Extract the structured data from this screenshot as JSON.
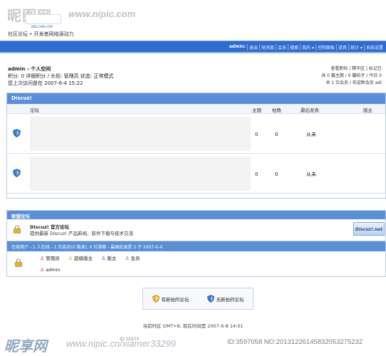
{
  "watermark": {
    "site_cn": "昵图网",
    "url_top": "www.nipic.com",
    "bottom_cn": "昵享网",
    "url_bottom": "www.nipic.cn/xiamer33299",
    "id_text": "ID:3597058 NO:20131226145832053275232",
    "tiny": "ID:35970"
  },
  "header": {
    "logo_sub": "BBS.CHIN.COM",
    "slogan": "社区论坛 • 开发者网络源动力"
  },
  "nav": {
    "items": [
      "admin:",
      "退出",
      "短消息",
      "会员",
      "搜索",
      "我的 ▾",
      "控制面板",
      "道具",
      "统计 ▾",
      "系统设置"
    ]
  },
  "user": {
    "title": "admin - 个人空间",
    "line2": "积分: 0 详细积分 / 头衔: 管理员 状态: 正常模式",
    "line3": "您上次访问是在 2007-6-4 15:22"
  },
  "right_info": {
    "line1": "查看新帖 | 精华区 | 标记已",
    "line2": "共 0 篇主题 / 0 篇帖子 / 今日 0",
    "line3": "共 1 位会员 / 欢迎新会员 adi"
  },
  "forum": {
    "category": "Discuz!",
    "columns": {
      "forum": "论坛",
      "topics": "主题",
      "posts": "帖数",
      "last": "最后发表",
      "moderator": "版主"
    },
    "rows": [
      {
        "topics": "0",
        "posts": "0",
        "last": "从未"
      },
      {
        "topics": "0",
        "posts": "0",
        "last": "从未"
      }
    ]
  },
  "league": {
    "title": "联盟论坛",
    "name": "Discuz! 官方论坛",
    "desc": "提供最新 Discuz! 产品新闻、软件下载与技术交流",
    "badge": "Discuz!.net"
  },
  "online": {
    "header": "在线用户 - 1 人在线 - 1 位会员(0 隐身), 0 位游客 - 最高纪录是 3 于 2007-6-4.",
    "legend": [
      "管理员",
      "超级版主",
      "版主",
      "会员"
    ],
    "user": "admin"
  },
  "icon_legend": {
    "new": "有新帖的论坛",
    "none": "无新帖的论坛"
  },
  "footer": {
    "text": "当前时区 GMT+8, 现在时间是 2007-6-8 14:01"
  },
  "colors": {
    "brand_blue": "#2f6ccf",
    "header_blue": "#5a8fd8"
  }
}
